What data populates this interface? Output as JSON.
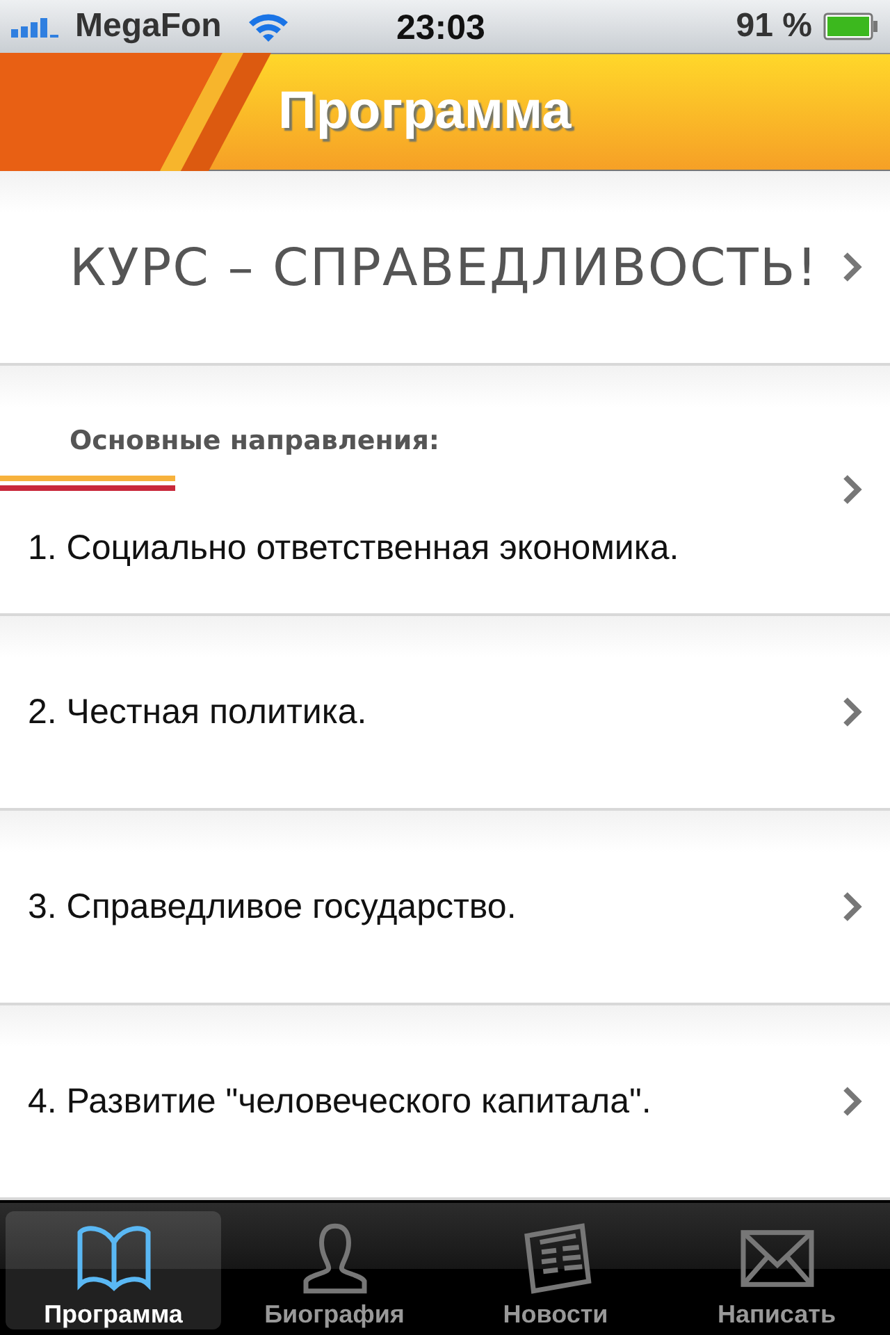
{
  "status_bar": {
    "carrier": "MegaFon",
    "time": "23:03",
    "battery": "91 %"
  },
  "header": {
    "title": "Программа"
  },
  "rows": [
    {
      "kind": "banner",
      "text": "КУРС – СПРАВЕДЛИВОСТЬ!"
    },
    {
      "kind": "item",
      "heading": "Основные направления:",
      "text": "1. Социально ответственная экономика."
    },
    {
      "kind": "item",
      "text": "2. Честная политика."
    },
    {
      "kind": "item",
      "text": "3. Справедливое государство."
    },
    {
      "kind": "item",
      "text": "4. Развитие \"человеческого капитала\"."
    }
  ],
  "tabs": [
    {
      "label": "Программа",
      "selected": true
    },
    {
      "label": "Биография",
      "selected": false
    },
    {
      "label": "Новости",
      "selected": false
    },
    {
      "label": "Написать",
      "selected": false
    }
  ]
}
